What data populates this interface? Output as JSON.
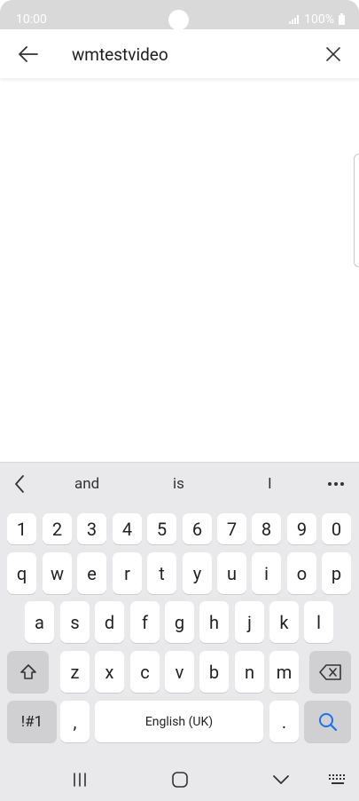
{
  "status_bar": {
    "time": "10:00",
    "battery": "100%"
  },
  "search": {
    "value": "wmtestvideo"
  },
  "keyboard": {
    "suggestions": [
      "and",
      "is",
      "I"
    ],
    "number_row": [
      "1",
      "2",
      "3",
      "4",
      "5",
      "6",
      "7",
      "8",
      "9",
      "0"
    ],
    "row1": [
      "q",
      "w",
      "e",
      "r",
      "t",
      "y",
      "u",
      "i",
      "o",
      "p"
    ],
    "row2": [
      "a",
      "s",
      "d",
      "f",
      "g",
      "h",
      "j",
      "k",
      "l"
    ],
    "row3": [
      "z",
      "x",
      "c",
      "v",
      "b",
      "n",
      "m"
    ],
    "symbols_label": "!#1",
    "comma_label": ",",
    "space_label": "English (UK)",
    "period_label": "."
  },
  "colors": {
    "accent": "#1a73e8",
    "keyboard_bg": "#e9e9eb",
    "status_bar_bg": "#d9d9d9"
  }
}
